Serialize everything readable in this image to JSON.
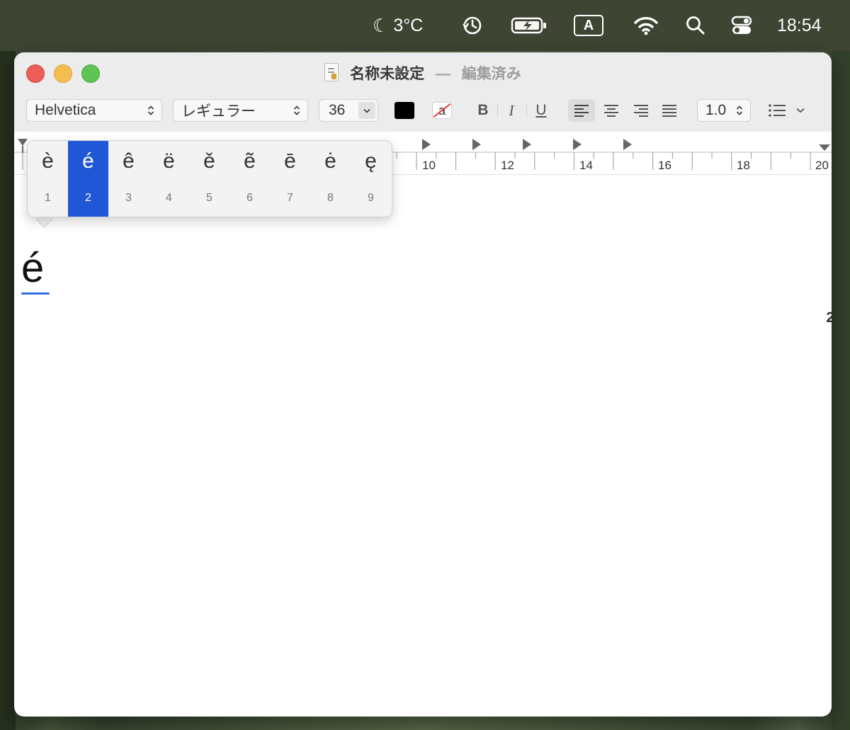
{
  "menubar": {
    "weather": "3°C",
    "input_source": "A",
    "time": "18:54"
  },
  "window": {
    "title": "名称未設定",
    "title_separator": "—",
    "edited_status": "編集済み",
    "toolbar": {
      "font_family": "Helvetica",
      "font_style": "レギュラー",
      "font_size": "36",
      "text_color": "#000000",
      "bold_label": "B",
      "italic_label": "I",
      "underline_label": "U",
      "line_spacing": "1.0"
    },
    "ruler_labels": [
      "10",
      "12",
      "14",
      "16",
      "18",
      "20"
    ],
    "document_text": "é",
    "right_edge_glyph": "2"
  },
  "accent_popup": {
    "selected_index": 1,
    "candidates": [
      {
        "char": "è",
        "number": "1"
      },
      {
        "char": "é",
        "number": "2"
      },
      {
        "char": "ê",
        "number": "3"
      },
      {
        "char": "ë",
        "number": "4"
      },
      {
        "char": "ě",
        "number": "5"
      },
      {
        "char": "ẽ",
        "number": "6"
      },
      {
        "char": "ē",
        "number": "7"
      },
      {
        "char": "ė",
        "number": "8"
      },
      {
        "char": "ę",
        "number": "9"
      }
    ]
  },
  "colors": {
    "selection": "#2057d6",
    "close": "#ec5f57",
    "minimize": "#f4bd4f",
    "zoom": "#5fc453",
    "marked_underline": "#2f6ee0"
  }
}
